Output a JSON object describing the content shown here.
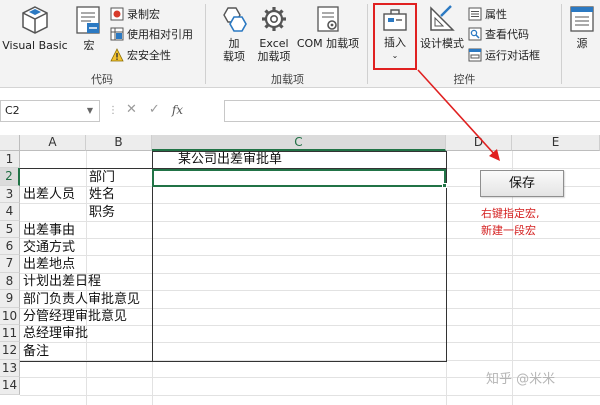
{
  "ribbon": {
    "code_group": {
      "label": "代码",
      "visual_basic": "Visual Basic",
      "macros": "宏",
      "record_macro": "录制宏",
      "relative_refs": "使用相对引用",
      "macro_security": "宏安全性"
    },
    "addins_group": {
      "label": "加载项",
      "addins": [
        "加",
        "载项"
      ],
      "excel_addins": [
        "Excel",
        "加载项"
      ],
      "com_addins": "COM 加载项"
    },
    "controls_group": {
      "label": "控件",
      "insert": "插入",
      "design_mode": "设计模式",
      "properties": "属性",
      "view_code": "查看代码",
      "run_dialog": "运行对话框"
    },
    "source": "源"
  },
  "formula_bar": {
    "name_box": "C2",
    "cancel": "✕",
    "enter": "✓",
    "fx": "fx",
    "content": ""
  },
  "sheet": {
    "columns": [
      "A",
      "B",
      "C",
      "D",
      "E"
    ],
    "rows": [
      "1",
      "2",
      "3",
      "4",
      "5",
      "6",
      "7",
      "8",
      "9",
      "10",
      "11",
      "12",
      "13",
      "14"
    ],
    "selected_cell": "C2",
    "title": "某公司出差审批单",
    "labels": {
      "dept": "部门",
      "traveler": "出差人员",
      "name": "姓名",
      "position": "职务",
      "reason": "出差事由",
      "transport": "交通方式",
      "place": "出差地点",
      "schedule": "计划出差日程",
      "dept_head": "部门负责人审批意见",
      "manager": "分管经理审批意见",
      "gm": "总经理审批",
      "remarks": "备注"
    }
  },
  "save_button": "保存",
  "annotation": {
    "line1": "右键指定宏,",
    "line2": "新建一段宏"
  },
  "watermark": "知乎 @米米",
  "colors": {
    "selection": "#217346",
    "highlight": "#e02020",
    "annotation_text": "#d42020"
  }
}
